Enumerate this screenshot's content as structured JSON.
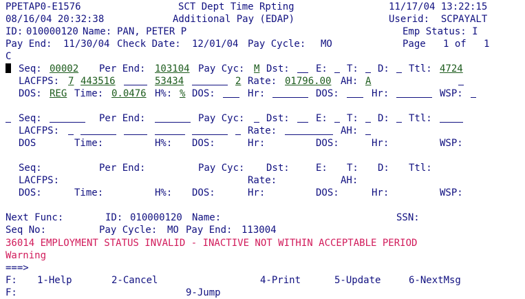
{
  "header": {
    "screen_id": "PPETAP0-E1576",
    "datetime": "08/16/04 20:32:38",
    "title1": "SCT Dept Time Rpting",
    "title2": "Additional Pay (EDAP)",
    "run_date": "11/17/04 13:22:15",
    "userid": "Userid:  SCPAYALT",
    "id_label": "ID:",
    "id_value": "010000120",
    "name_label": "Name:",
    "name_value": "PAN, PETER P",
    "emp_status": "Emp Status: I",
    "pay_end_label": "Pay End:",
    "pay_end": "11/30/04",
    "check_date_label": "Check Date:",
    "check_date": "12/01/04",
    "pay_cycle_label": "Pay Cycle:",
    "pay_cycle": "MO",
    "page": "Page   1 of   1",
    "c_mark": "C"
  },
  "record1": {
    "seq_label": "Seq:",
    "seq": "00002",
    "per_end_label": "Per End:",
    "per_end": "103104",
    "pay_cyc_label": "Pay Cyc:",
    "pay_cyc": "M",
    "dst_label": "Dst:",
    "e_label": "E:",
    "t_label": "T:",
    "d_label": "D:",
    "ttl_label": "Ttl:",
    "ttl": "4724",
    "lacfps_label": "LACFPS:",
    "lacfps1": "7",
    "lacfps2": "443516",
    "lacfps3": "53434",
    "lacfps4": "2",
    "rate_label": "Rate:",
    "rate": "01796.00",
    "ah_label": "AH:",
    "ah": "A",
    "dos_label": "DOS:",
    "dos": "REG",
    "time_label": "Time:",
    "time": "0.0476",
    "hpct_label": "H%:",
    "hpct": "%",
    "hr_label": "Hr:",
    "wsp_label": "WSP:"
  },
  "record2": {
    "seq_label": "Seq:",
    "per_end_label": "Per End:",
    "pay_cyc_label": "Pay Cyc:",
    "dst_label": "Dst:",
    "e_label": "E:",
    "t_label": "T:",
    "d_label": "D:",
    "ttl_label": "Ttl:",
    "lacfps_label": "LACFPS:",
    "rate_label": "Rate:",
    "ah_label": "AH:",
    "dos_label": "DOS",
    "time_label": "Time:",
    "hpct_label": "H%:",
    "dos2_label": "DOS:",
    "hr_label": "Hr:",
    "wsp_label": "WSP:"
  },
  "record3": {
    "seq_label": "Seq:",
    "per_end_label": "Per End:",
    "pay_cyc_label": "Pay Cyc:",
    "dst_label": "Dst:",
    "e_label": "E:",
    "t_label": "T:",
    "d_label": "D:",
    "ttl_label": "Ttl:",
    "lacfps_label": "LACFPS:",
    "rate_label": "Rate:",
    "ah_label": "AH:",
    "dos_label": "DOS:",
    "time_label": "Time:",
    "hpct_label": "H%:",
    "hr_label": "Hr:",
    "wsp_label": "WSP:"
  },
  "footer": {
    "next_func_label": "Next Func:",
    "id_label": "ID:",
    "id_value": "010000120",
    "name_label": "Name:",
    "ssn_label": "SSN:",
    "seq_no_label": "Seq No:",
    "pay_cycle_label": "Pay Cycle:",
    "pay_cycle": "MO",
    "pay_end_label": "Pay End:",
    "pay_end": "113004",
    "error_message": "36014 EMPLOYMENT STATUS INVALID - INACTIVE NOT WITHIN ACCEPTABLE PERIOD",
    "warning": "Warning",
    "prompt": "===>",
    "f_label": "F:",
    "f_label2": "F:"
  },
  "function_keys": {
    "help": "1-Help",
    "cancel": "2-Cancel",
    "print": "4-Print",
    "update": "5-Update",
    "nextmsg": "6-NextMsg",
    "jump": "9-Jump"
  },
  "colors": {
    "label": "#101080",
    "value": "#1c5b1c",
    "error": "#d11a5a"
  }
}
